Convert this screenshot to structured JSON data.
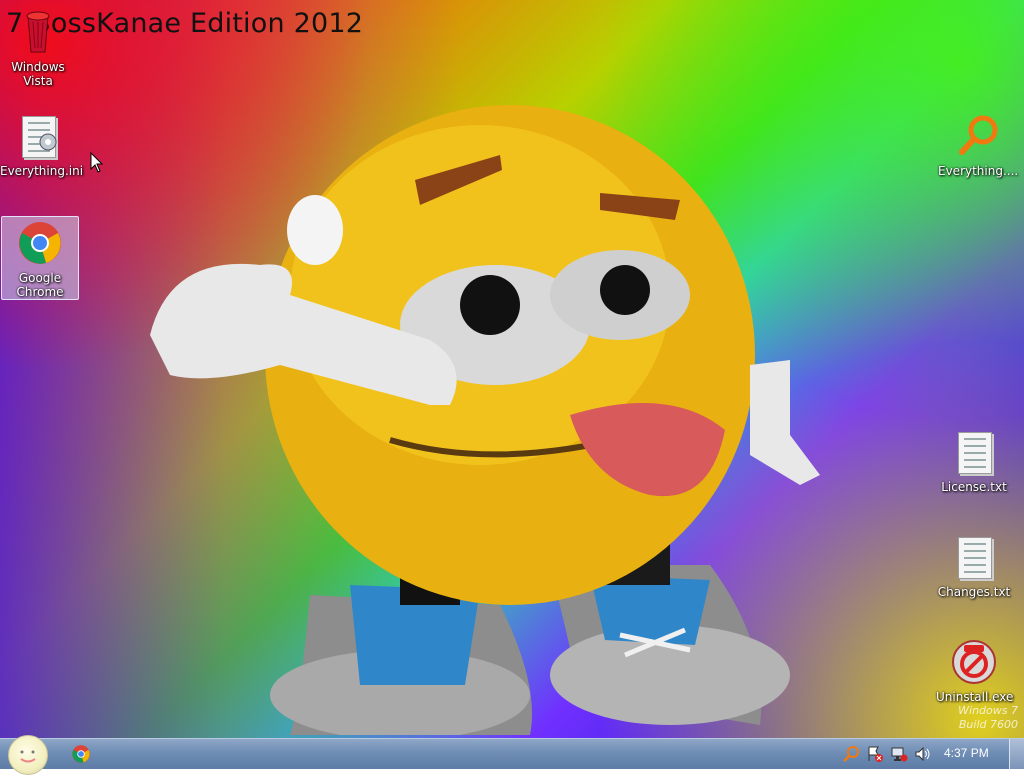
{
  "os_title": "7 BossKanae Edition 2012",
  "desktop_icons": [
    {
      "label": "Windows Vista",
      "icon": "recycle-bin-icon"
    },
    {
      "label": "Everything.ini",
      "icon": "settings-file-icon"
    },
    {
      "label": "Google Chrome",
      "icon": "chrome-icon",
      "selected": true
    },
    {
      "label": "Everything....",
      "icon": "search-icon"
    },
    {
      "label": "License.txt",
      "icon": "text-file-icon"
    },
    {
      "label": "Changes.txt",
      "icon": "text-file-icon"
    },
    {
      "label": "Uninstall.exe",
      "icon": "uninstall-icon"
    }
  ],
  "watermark": {
    "line1": "Windows 7",
    "line2": "Build 7600"
  },
  "taskbar": {
    "clock": "4:37 PM",
    "pinned": [
      "chrome-icon"
    ],
    "tray": [
      "search-icon",
      "action-center-icon",
      "network-icon",
      "volume-icon"
    ]
  },
  "colors": {
    "taskbar": "#6f8db5",
    "selection": "#c8d7f0"
  }
}
